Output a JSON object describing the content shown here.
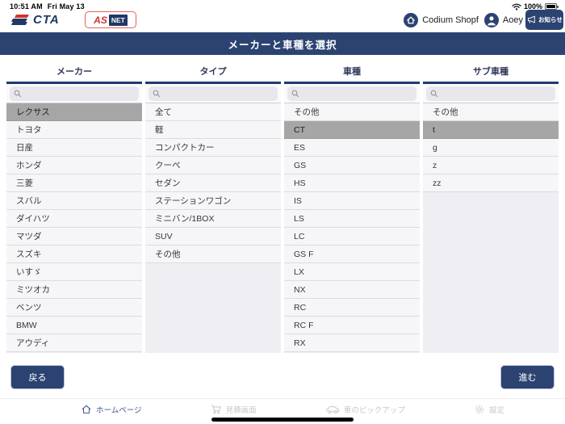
{
  "status_bar": {
    "time": "10:51 AM",
    "date": "Fri May 13",
    "battery": "100%"
  },
  "header": {
    "logo_cta": "CTA",
    "logo_asnet_as": "AS",
    "logo_asnet_net": "NET",
    "shop_name": "Codium Shopf",
    "user_name": "Aoey",
    "notice_button": "お知らせ"
  },
  "title_bar": {
    "title": "メーカーと車種を選択"
  },
  "columns": [
    {
      "header": "メーカー",
      "items": [
        {
          "label": "レクサス",
          "selected": true
        },
        {
          "label": "トヨタ",
          "selected": false
        },
        {
          "label": "日産",
          "selected": false
        },
        {
          "label": "ホンダ",
          "selected": false
        },
        {
          "label": "三菱",
          "selected": false
        },
        {
          "label": "スバル",
          "selected": false
        },
        {
          "label": "ダイハツ",
          "selected": false
        },
        {
          "label": "マツダ",
          "selected": false
        },
        {
          "label": "スズキ",
          "selected": false
        },
        {
          "label": "いすゞ",
          "selected": false
        },
        {
          "label": "ミツオカ",
          "selected": false
        },
        {
          "label": "ベンツ",
          "selected": false
        },
        {
          "label": "BMW",
          "selected": false
        },
        {
          "label": "アウディ",
          "selected": false
        }
      ]
    },
    {
      "header": "タイプ",
      "items": [
        {
          "label": "全て",
          "selected": false
        },
        {
          "label": "軽",
          "selected": false
        },
        {
          "label": "コンパクトカー",
          "selected": false
        },
        {
          "label": "クーペ",
          "selected": false
        },
        {
          "label": "セダン",
          "selected": false
        },
        {
          "label": "ステーションワゴン",
          "selected": false
        },
        {
          "label": "ミニバン/1BOX",
          "selected": false
        },
        {
          "label": "SUV",
          "selected": false
        },
        {
          "label": "その他",
          "selected": false
        }
      ]
    },
    {
      "header": "車種",
      "items": [
        {
          "label": "その他",
          "selected": false
        },
        {
          "label": "CT",
          "selected": true
        },
        {
          "label": "ES",
          "selected": false
        },
        {
          "label": "GS",
          "selected": false
        },
        {
          "label": "HS",
          "selected": false
        },
        {
          "label": "IS",
          "selected": false
        },
        {
          "label": "LS",
          "selected": false
        },
        {
          "label": "LC",
          "selected": false
        },
        {
          "label": "GS F",
          "selected": false
        },
        {
          "label": "LX",
          "selected": false
        },
        {
          "label": "NX",
          "selected": false
        },
        {
          "label": "RC",
          "selected": false
        },
        {
          "label": "RC F",
          "selected": false
        },
        {
          "label": "RX",
          "selected": false
        }
      ]
    },
    {
      "header": "サブ車種",
      "items": [
        {
          "label": "その他",
          "selected": false
        },
        {
          "label": "t",
          "selected": true
        },
        {
          "label": "g",
          "selected": false
        },
        {
          "label": "z",
          "selected": false
        },
        {
          "label": "zz",
          "selected": false
        }
      ]
    }
  ],
  "buttons": {
    "back": "戻る",
    "next": "進む"
  },
  "footer": {
    "items": [
      {
        "label": "ホームページ",
        "icon": "home-icon",
        "active": true
      },
      {
        "label": "見積画面",
        "icon": "cart-icon",
        "active": false
      },
      {
        "label": "車のピックアップ",
        "icon": "car-icon",
        "active": false
      },
      {
        "label": "設定",
        "icon": "gear-icon",
        "active": false
      }
    ]
  },
  "colors": {
    "navy": "#2c4372",
    "header_underline": "#1f3c70",
    "selected_gray": "#a6a6a6",
    "brand_red": "#d0342c",
    "footer_active": "#41598e",
    "footer_inactive": "#c8c8cc"
  }
}
